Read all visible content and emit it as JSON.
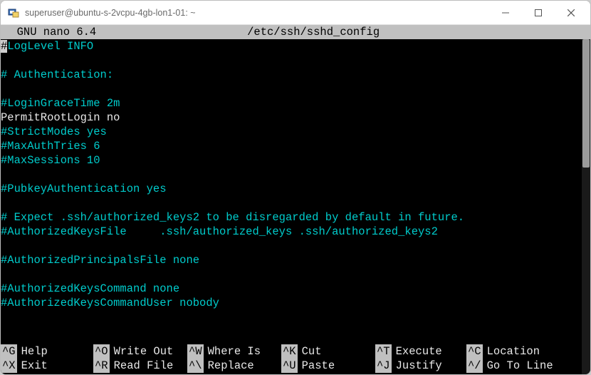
{
  "window": {
    "title": "superuser@ubuntu-s-2vcpu-4gb-lon1-01: ~"
  },
  "nano": {
    "header_left": "  GNU nano 6.4",
    "header_center": "/etc/ssh/sshd_config",
    "header_right": ""
  },
  "lines": [
    {
      "style": "cursor-first-cyan",
      "text": "#LogLevel INFO"
    },
    {
      "style": "blank",
      "text": ""
    },
    {
      "style": "cyan",
      "text": "# Authentication:"
    },
    {
      "style": "blank",
      "text": ""
    },
    {
      "style": "cyan",
      "text": "#LoginGraceTime 2m"
    },
    {
      "style": "white",
      "text": "PermitRootLogin no"
    },
    {
      "style": "cyan",
      "text": "#StrictModes yes"
    },
    {
      "style": "cyan",
      "text": "#MaxAuthTries 6"
    },
    {
      "style": "cyan",
      "text": "#MaxSessions 10"
    },
    {
      "style": "blank",
      "text": ""
    },
    {
      "style": "cyan",
      "text": "#PubkeyAuthentication yes"
    },
    {
      "style": "blank",
      "text": ""
    },
    {
      "style": "cyan",
      "text": "# Expect .ssh/authorized_keys2 to be disregarded by default in future."
    },
    {
      "style": "cyan",
      "text": "#AuthorizedKeysFile     .ssh/authorized_keys .ssh/authorized_keys2"
    },
    {
      "style": "blank",
      "text": ""
    },
    {
      "style": "cyan",
      "text": "#AuthorizedPrincipalsFile none"
    },
    {
      "style": "blank",
      "text": ""
    },
    {
      "style": "cyan",
      "text": "#AuthorizedKeysCommand none"
    },
    {
      "style": "cyan",
      "text": "#AuthorizedKeysCommandUser nobody"
    },
    {
      "style": "blank",
      "text": ""
    }
  ],
  "shortcuts": {
    "row1": [
      {
        "key": "^G",
        "label": "Help"
      },
      {
        "key": "^O",
        "label": "Write Out"
      },
      {
        "key": "^W",
        "label": "Where Is"
      },
      {
        "key": "^K",
        "label": "Cut"
      },
      {
        "key": "^T",
        "label": "Execute"
      },
      {
        "key": "^C",
        "label": "Location"
      }
    ],
    "row2": [
      {
        "key": "^X",
        "label": "Exit"
      },
      {
        "key": "^R",
        "label": "Read File"
      },
      {
        "key": "^\\",
        "label": "Replace"
      },
      {
        "key": "^U",
        "label": "Paste"
      },
      {
        "key": "^J",
        "label": "Justify"
      },
      {
        "key": "^/",
        "label": "Go To Line"
      }
    ]
  }
}
